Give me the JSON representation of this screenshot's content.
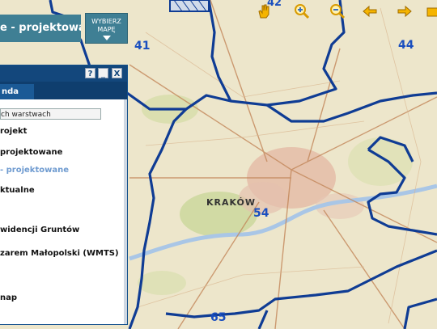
{
  "header": {
    "title": "e - projektowane",
    "map_button": {
      "line1": "WYBIERZ",
      "line2": "MAPĘ"
    }
  },
  "toolbar": {
    "items": [
      "pan-icon",
      "zoom-in-icon",
      "zoom-out-icon",
      "back-arrow-icon",
      "forward-arrow-icon"
    ],
    "badge": "42"
  },
  "map": {
    "city_label": "KRAKÓW",
    "district_numbers": [
      "41",
      "44",
      "54",
      "65"
    ],
    "border_color": "#0f3c94"
  },
  "panel": {
    "buttons": [
      "?",
      "_",
      "X"
    ],
    "tab": "nda",
    "search_button": "ch warstwach",
    "items": [
      "rojekt",
      "projektowane",
      "- projektowane",
      "ktualne",
      "widencji Gruntów",
      "zarem Małopolski (WMTS)",
      "nap"
    ],
    "highlighted_index": 2
  }
}
